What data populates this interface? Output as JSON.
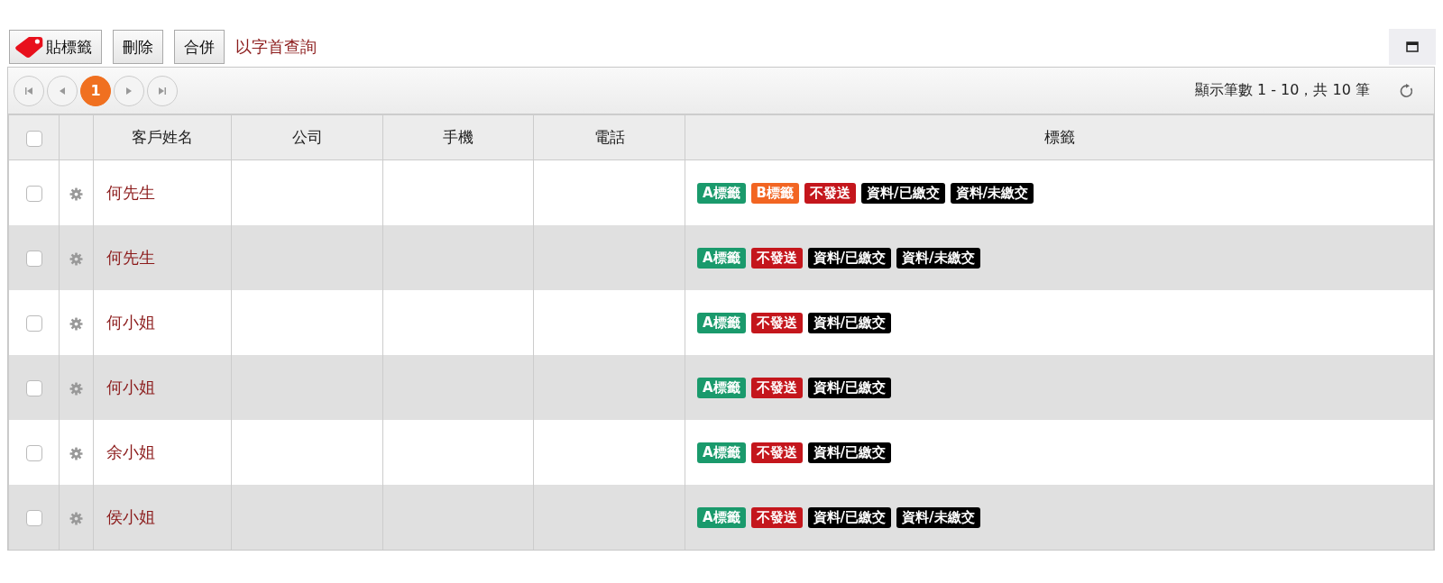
{
  "toolbar": {
    "buttons": [
      {
        "label": "貼標籤",
        "kind": "tag"
      },
      {
        "label": "刪除",
        "kind": "plain"
      },
      {
        "label": "合併",
        "kind": "plain"
      }
    ],
    "link": "以字首查詢"
  },
  "pager": {
    "pages": [
      {
        "label": "1",
        "selected": true
      }
    ],
    "summary": "顯示筆數 1 - 10，共 10 筆"
  },
  "table": {
    "header_checked": false,
    "columns": [
      "客戶姓名",
      "公司",
      "手機",
      "電話",
      "標籤"
    ],
    "rows": [
      {
        "checked": false,
        "name": "何先生",
        "tags": [
          {
            "label": "A標籤",
            "color": "#1a9a6c"
          },
          {
            "label": "B標籤",
            "color": "#f26522"
          },
          {
            "label": "不發送",
            "color": "#c4161c"
          },
          {
            "label": "資料/已繳交",
            "color": "#000000"
          },
          {
            "label": "資料/未繳交",
            "color": "#000000"
          }
        ]
      },
      {
        "checked": false,
        "name": "何先生",
        "tags": [
          {
            "label": "A標籤",
            "color": "#1a9a6c"
          },
          {
            "label": "不發送",
            "color": "#c4161c"
          },
          {
            "label": "資料/已繳交",
            "color": "#000000"
          },
          {
            "label": "資料/未繳交",
            "color": "#000000"
          }
        ]
      },
      {
        "checked": false,
        "name": "何小姐",
        "tags": [
          {
            "label": "A標籤",
            "color": "#1a9a6c"
          },
          {
            "label": "不發送",
            "color": "#c4161c"
          },
          {
            "label": "資料/已繳交",
            "color": "#000000"
          }
        ]
      },
      {
        "checked": false,
        "name": "何小姐",
        "tags": [
          {
            "label": "A標籤",
            "color": "#1a9a6c"
          },
          {
            "label": "不發送",
            "color": "#c4161c"
          },
          {
            "label": "資料/已繳交",
            "color": "#000000"
          }
        ]
      },
      {
        "checked": false,
        "name": "余小姐",
        "tags": [
          {
            "label": "A標籤",
            "color": "#1a9a6c"
          },
          {
            "label": "不發送",
            "color": "#c4161c"
          },
          {
            "label": "資料/已繳交",
            "color": "#000000"
          }
        ]
      },
      {
        "checked": false,
        "name": "侯小姐",
        "tags": [
          {
            "label": "A標籤",
            "color": "#1a9a6c"
          },
          {
            "label": "不發送",
            "color": "#c4161c"
          },
          {
            "label": "資料/已繳交",
            "color": "#000000"
          },
          {
            "label": "資料/未繳交",
            "color": "#000000"
          }
        ]
      }
    ]
  }
}
